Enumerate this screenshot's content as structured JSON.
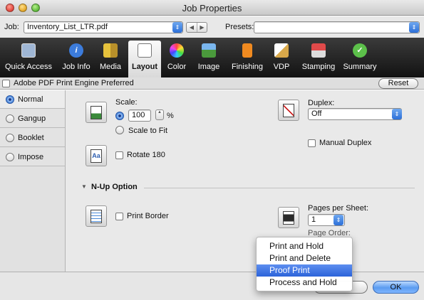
{
  "window": {
    "title": "Job Properties"
  },
  "jobbar": {
    "job_label": "Job:",
    "job_value": "Inventory_List_LTR.pdf",
    "presets_label": "Presets:",
    "presets_value": ""
  },
  "toolbar": {
    "items": [
      {
        "label": "Quick Access",
        "icon": "quick-access-icon",
        "color": "#9fb6d4"
      },
      {
        "label": "Job Info",
        "icon": "info-icon",
        "color": "#3c7cdc"
      },
      {
        "label": "Media",
        "icon": "media-icon",
        "color": "#e6c23c"
      },
      {
        "label": "Layout",
        "icon": "layout-icon",
        "color": "#ffffff"
      },
      {
        "label": "Color",
        "icon": "color-wheel-icon",
        "color": "#d84bd0"
      },
      {
        "label": "Image",
        "icon": "image-icon",
        "color": "#4a9a3c"
      },
      {
        "label": "Finishing",
        "icon": "finishing-icon",
        "color": "#f08a20"
      },
      {
        "label": "VDP",
        "icon": "vdp-icon",
        "color": "#d8a84a"
      },
      {
        "label": "Stamping",
        "icon": "stamping-icon",
        "color": "#e04a4a"
      },
      {
        "label": "Summary",
        "icon": "summary-check-icon",
        "color": "#5cc04a"
      }
    ],
    "active": "Layout"
  },
  "prefbar": {
    "label": "Adobe PDF Print Engine Preferred",
    "reset_label": "Reset"
  },
  "sidebar": {
    "items": [
      {
        "label": "Normal",
        "selected": true
      },
      {
        "label": "Gangup",
        "selected": false
      },
      {
        "label": "Booklet",
        "selected": false
      },
      {
        "label": "Impose",
        "selected": false
      }
    ]
  },
  "main": {
    "scale_label": "Scale:",
    "scale_value": "100",
    "scale_unit": "%",
    "scale_to_fit_label": "Scale to Fit",
    "rotate_label": "Rotate 180",
    "duplex_label": "Duplex:",
    "duplex_value": "Off",
    "manual_duplex_label": "Manual Duplex",
    "nup_section_label": "N-Up Option",
    "print_border_label": "Print Border",
    "pages_per_sheet_label": "Pages per Sheet:",
    "pages_per_sheet_value": "1",
    "page_order_label": "Page Order:"
  },
  "dropdown_menu": {
    "items": [
      "Print and Hold",
      "Print and Delete",
      "Proof Print",
      "Process and Hold"
    ],
    "highlighted": "Proof Print"
  },
  "bottom": {
    "ok_label": "OK"
  },
  "colors": {
    "accent": "#3c74dc",
    "toolbar_bg": "#1e1e1e"
  }
}
